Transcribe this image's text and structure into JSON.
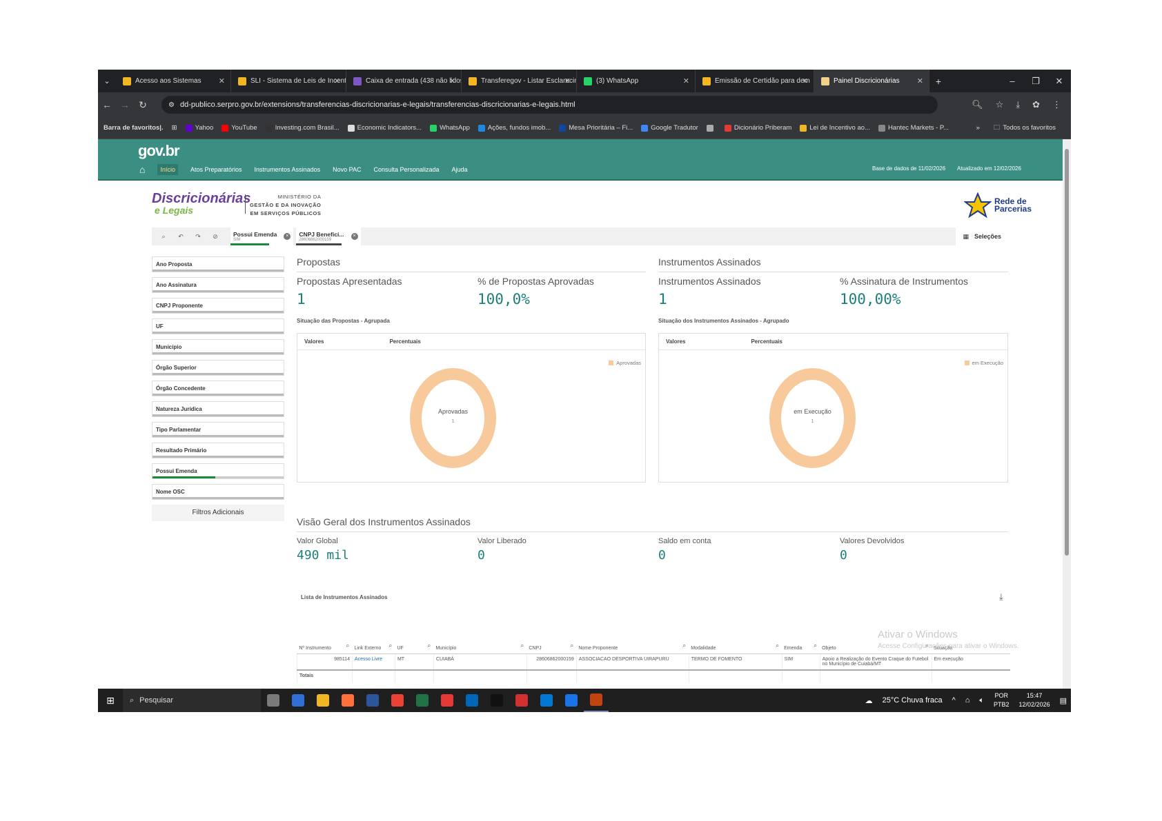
{
  "browser": {
    "tabs": [
      {
        "title": "Acesso aos Sistemas",
        "color": "#f1b621"
      },
      {
        "title": "SLI - Sistema de Leis de Incenti",
        "color": "#f1b621"
      },
      {
        "title": "Caixa de entrada (438 não lidos",
        "color": "#7e57c2"
      },
      {
        "title": "Transferegov - Listar Esclarecim",
        "color": "#f1b621"
      },
      {
        "title": "(3) WhatsApp",
        "color": "#25d366"
      },
      {
        "title": "Emissão de Certidão para dem",
        "color": "#f1b621"
      },
      {
        "title": "Painel Discricionárias",
        "color": "#f1d28a",
        "active": true
      }
    ],
    "url": "dd-publico.serpro.gov.br/extensions/transferencias-discricionarias-e-legais/transferencias-discricionarias-e-legais.html",
    "bookmarks_label": "Barra de favoritos|.",
    "bookmarks": [
      {
        "label": "Yahoo",
        "color": "#6001d2"
      },
      {
        "label": "YouTube",
        "color": "#ff0000"
      },
      {
        "label": "Investing.com Brasil...",
        "color": "#333"
      },
      {
        "label": "Economic Indicators...",
        "color": "#ddd"
      },
      {
        "label": "WhatsApp",
        "color": "#25d366"
      },
      {
        "label": "Ações, fundos imob...",
        "color": "#1e88e5"
      },
      {
        "label": "Mesa Prioritária – Fi...",
        "color": "#0d47a1"
      },
      {
        "label": "Google Tradutor",
        "color": "#4285f4"
      },
      {
        "label": "",
        "color": "#aaa"
      },
      {
        "label": "Dicionário Priberam",
        "color": "#e53935"
      },
      {
        "label": "Lei de Incentivo ao...",
        "color": "#f1b621"
      },
      {
        "label": "Hantec Markets - P...",
        "color": "#888"
      }
    ],
    "all_bookmarks": "Todos os favoritos"
  },
  "gov": {
    "logo": "gov.br",
    "nav": [
      "Início",
      "Atos Preparatórios",
      "Instrumentos Assinados",
      "Novo PAC",
      "Consulta Personalizada",
      "Ajuda"
    ],
    "base_date": "Base de dados de 11/02/2026",
    "updated": "Atualizado em 12/02/2026"
  },
  "brand": {
    "line1": "Discricionárias",
    "line2": "e Legais",
    "ministry1": "MINISTÉRIO DA",
    "ministry2": "GESTÃO E DA INOVAÇÃO",
    "ministry3": "EM SERVIÇOS PÚBLICOS",
    "rede1": "Rede de",
    "rede2": "Parcerias"
  },
  "selections": {
    "chips": [
      {
        "title": "Possui Emenda",
        "value": "SIM"
      },
      {
        "title": "CNPJ Benefici...",
        "value": "28606862000159"
      }
    ],
    "label": "Seleções"
  },
  "filters": [
    "Ano Proposta",
    "Ano Assinatura",
    "CNPJ Proponente",
    "UF",
    "Município",
    "Órgão Superior",
    "Órgão Concedente",
    "Natureza Jurídica",
    "Tipo Parlamentar",
    "Resultado Primário",
    "Possui Emenda",
    "Nome OSC"
  ],
  "filters_more": "Filtros Adicionais",
  "propostas": {
    "title": "Propostas",
    "k1_label": "Propostas Apresentadas",
    "k1_value": "1",
    "k2_label": "% de Propostas Aprovadas",
    "k2_value": "100,0%",
    "sub": "Situação das Propostas - Agrupada",
    "col1": "Valores",
    "col2": "Percentuais",
    "legend": "Aprovadas",
    "center": "Aprovadas",
    "center_value": "1"
  },
  "instrumentos": {
    "title": "Instrumentos Assinados",
    "k1_label": "Instrumentos Assinados",
    "k1_value": "1",
    "k2_label": "% Assinatura de Instrumentos",
    "k2_value": "100,00%",
    "sub": "Situação dos Instrumentos Assinados - Agrupado",
    "col1": "Valores",
    "col2": "Percentuais",
    "legend": "em Execução",
    "center": "em Execução",
    "center_value": "1"
  },
  "overview": {
    "title": "Visão Geral dos Instrumentos Assinados",
    "items": [
      {
        "label": "Valor Global",
        "value": "490 mil"
      },
      {
        "label": "Valor Liberado",
        "value": "0"
      },
      {
        "label": "Saldo em conta",
        "value": "0"
      },
      {
        "label": "Valores Devolvidos",
        "value": "0"
      }
    ]
  },
  "table": {
    "title": "Lista de Instrumentos Assinados",
    "headers": [
      "Nº Instrumento",
      "Link Externo",
      "UF",
      "Município",
      "CNPJ",
      "Nome Proponente",
      "Modalidade",
      "Emenda",
      "Objeto",
      "Situação"
    ],
    "rows": [
      [
        "985114",
        "Acesso Livre",
        "MT",
        "CUIABÁ",
        "28606862000159",
        "ASSOCIACAO DESPORTIVA UIRAPURU",
        "TERMO DE FOMENTO",
        "SIM",
        "Apoio a Realização do Evento Craque do Futebol no Município de Cuiabá/MT",
        "Em execução"
      ]
    ],
    "totals": "Totais"
  },
  "watermark": {
    "line1": "Ativar o Windows",
    "line2": "Acesse Configurações para ativar o Windows."
  },
  "taskbar": {
    "search": "Pesquisar",
    "weather": "25°C Chuva fraca",
    "lang1": "POR",
    "lang2": "PTB2",
    "time": "15:47",
    "date": "12/02/2026",
    "apps": [
      "#7a7a7a",
      "#2f6fd6",
      "#f1b621",
      "#ff7139",
      "#2b579a",
      "#ea4335",
      "#217346",
      "#e53935",
      "#0067b8",
      "#111",
      "#d32f2f",
      "#0078d4",
      "#1a73e8",
      "#c1440e"
    ]
  }
}
